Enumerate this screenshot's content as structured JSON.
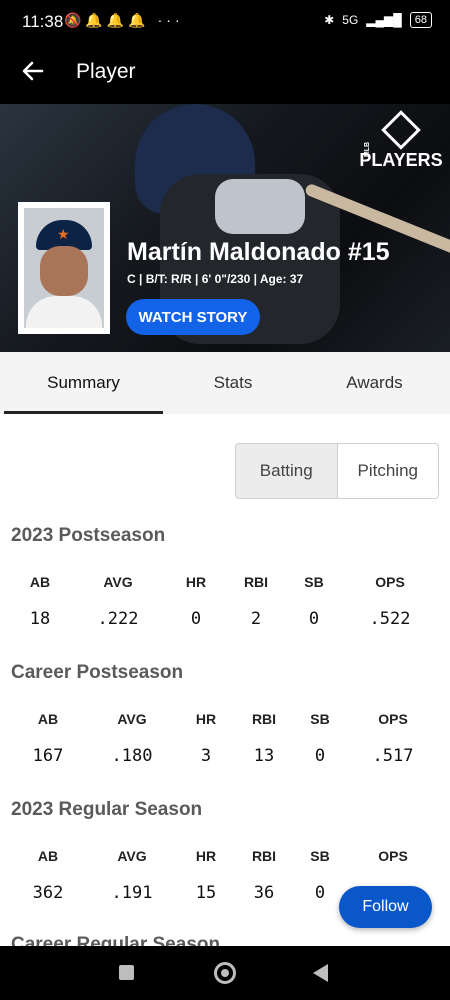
{
  "status": {
    "time": "11:38",
    "battery": "68",
    "network": "5G"
  },
  "header": {
    "title": "Player"
  },
  "hero": {
    "brand": "PLAYERS",
    "brand_sub": "MLB"
  },
  "player": {
    "name": "Martín Maldonado #15",
    "info": "C | B/T: R/R | 6' 0\"/230 | Age: 37",
    "watch_label": "WATCH STORY"
  },
  "tabs": [
    {
      "label": "Summary",
      "active": true
    },
    {
      "label": "Stats",
      "active": false
    },
    {
      "label": "Awards",
      "active": false
    }
  ],
  "toggle": {
    "batting": "Batting",
    "pitching": "Pitching",
    "selected": "Batting"
  },
  "sections": [
    {
      "title": "2023 Postseason",
      "headers": [
        "AB",
        "AVG",
        "HR",
        "RBI",
        "SB",
        "OPS"
      ],
      "values": [
        "18",
        ".222",
        "0",
        "2",
        "0",
        ".522"
      ]
    },
    {
      "title": "Career Postseason",
      "headers": [
        "AB",
        "AVG",
        "HR",
        "RBI",
        "SB",
        "OPS"
      ],
      "values": [
        "167",
        ".180",
        "3",
        "13",
        "0",
        ".517"
      ]
    },
    {
      "title": "2023 Regular Season",
      "headers": [
        "AB",
        "AVG",
        "HR",
        "RBI",
        "SB",
        "OPS"
      ],
      "values": [
        "362",
        ".191",
        "15",
        "36",
        "0",
        ""
      ]
    },
    {
      "title": "Career Regular Season"
    }
  ],
  "follow_label": "Follow",
  "colors": {
    "accent": "#1263e8",
    "follow": "#0a57c9"
  }
}
